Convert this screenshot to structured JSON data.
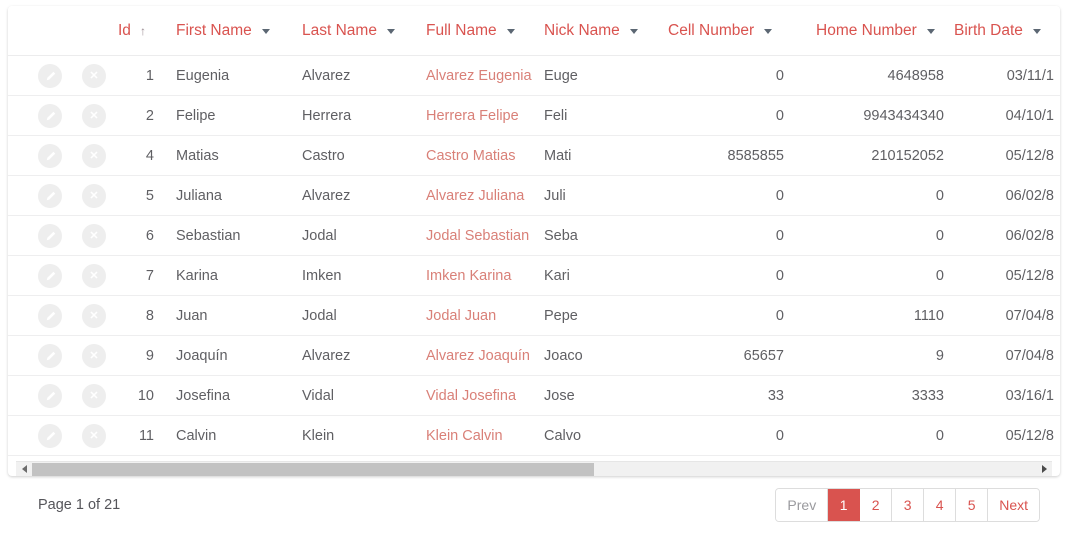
{
  "colors": {
    "accent": "#d9534f",
    "accent_cell": "#d98078",
    "text": "#5f5f63",
    "muted": "#9a9a9e",
    "border": "#eeeeef",
    "action_bg": "#eeeeee",
    "scroll_thumb": "#c2c2c2"
  },
  "table": {
    "columns": [
      {
        "key": "id",
        "label": "Id",
        "sort": "asc",
        "menu": false,
        "align": "right"
      },
      {
        "key": "first_name",
        "label": "First Name",
        "sort": null,
        "menu": true,
        "align": "left"
      },
      {
        "key": "last_name",
        "label": "Last Name",
        "sort": null,
        "menu": true,
        "align": "left"
      },
      {
        "key": "full_name",
        "label": "Full Name",
        "sort": null,
        "menu": true,
        "align": "left"
      },
      {
        "key": "nick_name",
        "label": "Nick Name",
        "sort": null,
        "menu": true,
        "align": "left"
      },
      {
        "key": "cell_number",
        "label": "Cell Number",
        "sort": null,
        "menu": true,
        "align": "right"
      },
      {
        "key": "home_number",
        "label": "Home Number",
        "sort": null,
        "menu": true,
        "align": "right"
      },
      {
        "key": "birth_date",
        "label": "Birth Date",
        "sort": null,
        "menu": true,
        "align": "right"
      }
    ],
    "row_actions": [
      {
        "name": "edit-row-button",
        "icon": "pencil-icon",
        "title": "Edit"
      },
      {
        "name": "delete-row-button",
        "icon": "close-icon",
        "title": "Delete"
      }
    ],
    "rows": [
      {
        "id": "1",
        "first_name": "Eugenia",
        "last_name": "Alvarez",
        "full_name": "Alvarez Eugenia",
        "nick_name": "Euge",
        "cell_number": "0",
        "home_number": "4648958",
        "birth_date": "03/11/1"
      },
      {
        "id": "2",
        "first_name": "Felipe",
        "last_name": "Herrera",
        "full_name": "Herrera Felipe",
        "nick_name": "Feli",
        "cell_number": "0",
        "home_number": "9943434340",
        "birth_date": "04/10/1"
      },
      {
        "id": "4",
        "first_name": "Matias",
        "last_name": "Castro",
        "full_name": "Castro Matias",
        "nick_name": "Mati",
        "cell_number": "8585855",
        "home_number": "210152052",
        "birth_date": "05/12/8"
      },
      {
        "id": "5",
        "first_name": "Juliana",
        "last_name": "Alvarez",
        "full_name": "Alvarez Juliana",
        "nick_name": "Juli",
        "cell_number": "0",
        "home_number": "0",
        "birth_date": "06/02/8"
      },
      {
        "id": "6",
        "first_name": "Sebastian",
        "last_name": "Jodal",
        "full_name": "Jodal Sebastian",
        "nick_name": "Seba",
        "cell_number": "0",
        "home_number": "0",
        "birth_date": "06/02/8"
      },
      {
        "id": "7",
        "first_name": "Karina",
        "last_name": "Imken",
        "full_name": "Imken Karina",
        "nick_name": "Kari",
        "cell_number": "0",
        "home_number": "0",
        "birth_date": "05/12/8"
      },
      {
        "id": "8",
        "first_name": "Juan",
        "last_name": "Jodal",
        "full_name": "Jodal Juan",
        "nick_name": "Pepe",
        "cell_number": "0",
        "home_number": "1110",
        "birth_date": "07/04/8"
      },
      {
        "id": "9",
        "first_name": "Joaquín",
        "last_name": "Alvarez",
        "full_name": "Alvarez Joaquín",
        "nick_name": "Joaco",
        "cell_number": "65657",
        "home_number": "9",
        "birth_date": "07/04/8"
      },
      {
        "id": "10",
        "first_name": "Josefina",
        "last_name": "Vidal",
        "full_name": "Vidal Josefina",
        "nick_name": "Jose",
        "cell_number": "33",
        "home_number": "3333",
        "birth_date": "03/16/1"
      },
      {
        "id": "11",
        "first_name": "Calvin",
        "last_name": "Klein",
        "full_name": "Klein Calvin",
        "nick_name": "Calvo",
        "cell_number": "0",
        "home_number": "0",
        "birth_date": "05/12/8"
      }
    ]
  },
  "scrollbar": {
    "left_arrow_icon": "chevron-left-icon",
    "right_arrow_icon": "chevron-right-icon",
    "thumb_percent": 56
  },
  "footer": {
    "page_info": "Page 1 of 21",
    "pager": [
      {
        "label": "Prev",
        "name": "pager-prev",
        "state": "disabled"
      },
      {
        "label": "1",
        "name": "pager-page-1",
        "state": "active"
      },
      {
        "label": "2",
        "name": "pager-page-2",
        "state": "normal"
      },
      {
        "label": "3",
        "name": "pager-page-3",
        "state": "normal"
      },
      {
        "label": "4",
        "name": "pager-page-4",
        "state": "normal"
      },
      {
        "label": "5",
        "name": "pager-page-5",
        "state": "normal"
      },
      {
        "label": "Next",
        "name": "pager-next",
        "state": "normal"
      }
    ]
  }
}
